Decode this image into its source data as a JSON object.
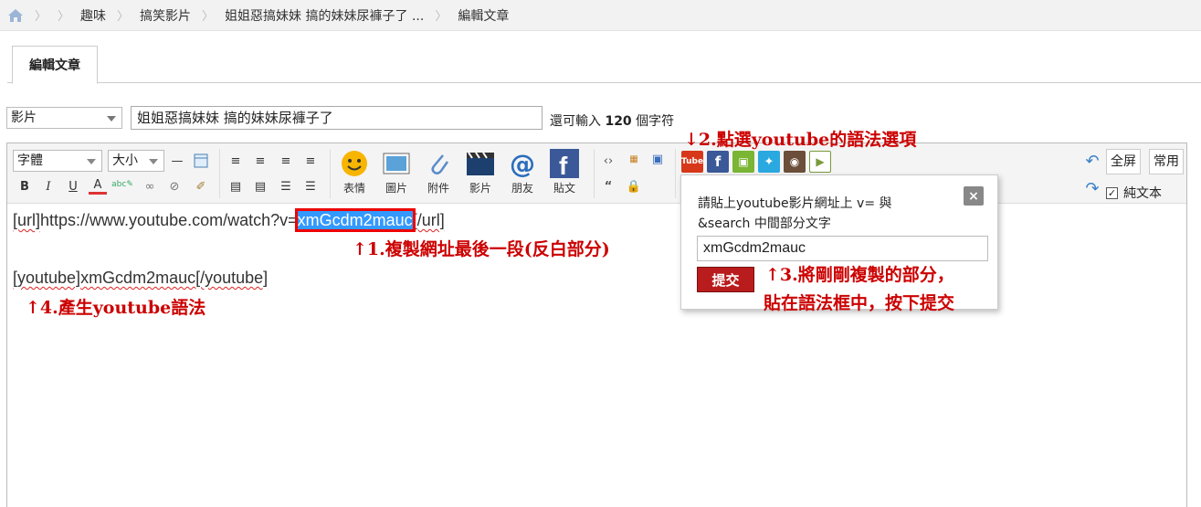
{
  "breadcrumb": {
    "items": [
      "趣味",
      "搞笑影片",
      "姐姐惡搞妹妹 搞的妹妹尿褲子了 ...",
      "編輯文章"
    ]
  },
  "tabs": {
    "active": "編輯文章"
  },
  "form": {
    "category": "影片",
    "title_value": "姐姐惡搞妹妹 搞的妹妹尿褲子了",
    "remain_prefix": "還可輸入",
    "remain_count": "120",
    "remain_suffix": "個字符"
  },
  "toolbar": {
    "font_label": "字體",
    "size_label": "大小",
    "emoji_label": "表情",
    "image_label": "圖片",
    "attach_label": "附件",
    "video_label": "影片",
    "friend_label": "朋友",
    "post_label": "貼文",
    "fullscreen_label": "全屏",
    "common_label": "常用",
    "plaintext_label": "純文本"
  },
  "content": {
    "line1_a": "[url]",
    "line1_b": "https://www.youtube.com/watch?v=",
    "line1_highlight": "xmGcdm2mauc",
    "line1_c": "[/url]",
    "line2_a": "[youtube]",
    "line2_b": "xmGcdm2mauc",
    "line2_c": "[/youtube]"
  },
  "popup": {
    "instruction_line1": "請貼上youtube影片網址上 v= 與",
    "instruction_line2": "&search 中間部分文字",
    "input_value": "xmGcdm2mauc",
    "submit_label": "提交",
    "close_label": "×"
  },
  "annotations": {
    "step1": "↑1.複製網址最後一段(反白部分)",
    "step2": "↓2.點選youtube的語法選項",
    "step3_line1": "↑3.將剛剛複製的部分，",
    "step3_line2": "貼在語法框中，按下提交",
    "step4": "↑4.產生youtube語法"
  },
  "colors": {
    "annotation": "#cc0000",
    "highlight": "#3399ff",
    "submit": "#b91c1c"
  }
}
